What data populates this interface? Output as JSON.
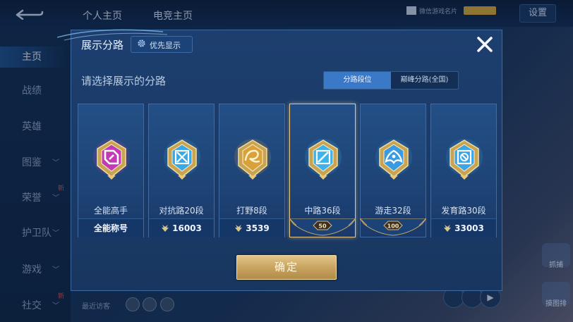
{
  "background": {
    "top_tabs": [
      "个人主页",
      "电竞主页"
    ],
    "card_label": "微信游戏名片",
    "settings_label": "设置",
    "sidebar": [
      {
        "label": "主页",
        "active": true,
        "chevron": false,
        "new": false
      },
      {
        "label": "战绩",
        "active": false,
        "chevron": false,
        "new": false
      },
      {
        "label": "英雄",
        "active": false,
        "chevron": false,
        "new": false
      },
      {
        "label": "图鉴",
        "active": false,
        "chevron": true,
        "new": false
      },
      {
        "label": "荣誉",
        "active": false,
        "chevron": true,
        "new": true
      },
      {
        "label": "护卫队",
        "active": false,
        "chevron": true,
        "new": false
      },
      {
        "label": "游戏",
        "active": false,
        "chevron": true,
        "new": false
      },
      {
        "label": "社交",
        "active": false,
        "chevron": true,
        "new": true
      }
    ],
    "new_tag": "新",
    "recent_label": "最近访客",
    "right_buttons": [
      "抓捕",
      "摸图排"
    ]
  },
  "modal": {
    "title": "展示分路",
    "priority_button": "优先显示",
    "subtitle": "请选择展示的分路",
    "toggle": {
      "active": "分路段位",
      "inactive": "巅峰分路(全国)"
    },
    "confirm_label": "确定",
    "cards": [
      {
        "label": "全能高手",
        "footer_text": "全能称号",
        "footer_type": "title",
        "icon": "all-round-badge-icon",
        "color": "#c13bb4",
        "selected": false
      },
      {
        "label": "对抗路20段",
        "footer_text": "16003",
        "footer_type": "score",
        "icon": "clash-lane-badge-icon",
        "color": "#38a8e6",
        "selected": false
      },
      {
        "label": "打野8段",
        "footer_text": "3539",
        "footer_type": "score",
        "icon": "jungle-badge-icon",
        "color": "#d9a13c",
        "selected": false
      },
      {
        "label": "中路36段",
        "footer_text": "50",
        "footer_type": "rank",
        "icon": "mid-lane-badge-icon",
        "color": "#3cb3ea",
        "selected": true
      },
      {
        "label": "游走32段",
        "footer_text": "100",
        "footer_type": "rank",
        "icon": "roam-badge-icon",
        "color": "#3a9be0",
        "selected": false
      },
      {
        "label": "发育路30段",
        "footer_text": "33003",
        "footer_type": "score",
        "icon": "farm-lane-badge-icon",
        "color": "#3aa6e6",
        "selected": false
      }
    ]
  }
}
